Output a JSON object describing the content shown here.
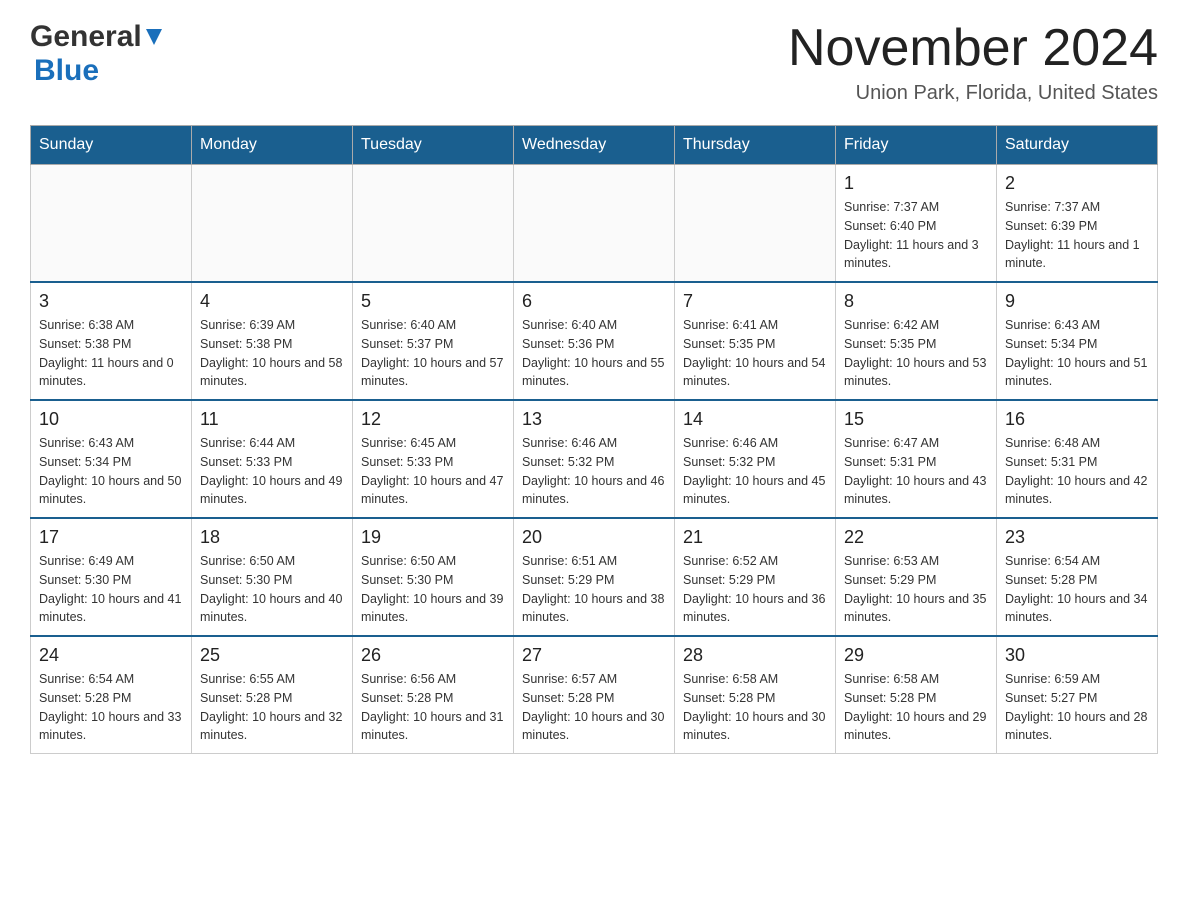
{
  "logo": {
    "general": "General",
    "triangle": "▶",
    "blue": "Blue"
  },
  "title": "November 2024",
  "subtitle": "Union Park, Florida, United States",
  "days_of_week": [
    "Sunday",
    "Monday",
    "Tuesday",
    "Wednesday",
    "Thursday",
    "Friday",
    "Saturday"
  ],
  "weeks": [
    [
      {
        "day": "",
        "info": ""
      },
      {
        "day": "",
        "info": ""
      },
      {
        "day": "",
        "info": ""
      },
      {
        "day": "",
        "info": ""
      },
      {
        "day": "",
        "info": ""
      },
      {
        "day": "1",
        "info": "Sunrise: 7:37 AM\nSunset: 6:40 PM\nDaylight: 11 hours and 3 minutes."
      },
      {
        "day": "2",
        "info": "Sunrise: 7:37 AM\nSunset: 6:39 PM\nDaylight: 11 hours and 1 minute."
      }
    ],
    [
      {
        "day": "3",
        "info": "Sunrise: 6:38 AM\nSunset: 5:38 PM\nDaylight: 11 hours and 0 minutes."
      },
      {
        "day": "4",
        "info": "Sunrise: 6:39 AM\nSunset: 5:38 PM\nDaylight: 10 hours and 58 minutes."
      },
      {
        "day": "5",
        "info": "Sunrise: 6:40 AM\nSunset: 5:37 PM\nDaylight: 10 hours and 57 minutes."
      },
      {
        "day": "6",
        "info": "Sunrise: 6:40 AM\nSunset: 5:36 PM\nDaylight: 10 hours and 55 minutes."
      },
      {
        "day": "7",
        "info": "Sunrise: 6:41 AM\nSunset: 5:35 PM\nDaylight: 10 hours and 54 minutes."
      },
      {
        "day": "8",
        "info": "Sunrise: 6:42 AM\nSunset: 5:35 PM\nDaylight: 10 hours and 53 minutes."
      },
      {
        "day": "9",
        "info": "Sunrise: 6:43 AM\nSunset: 5:34 PM\nDaylight: 10 hours and 51 minutes."
      }
    ],
    [
      {
        "day": "10",
        "info": "Sunrise: 6:43 AM\nSunset: 5:34 PM\nDaylight: 10 hours and 50 minutes."
      },
      {
        "day": "11",
        "info": "Sunrise: 6:44 AM\nSunset: 5:33 PM\nDaylight: 10 hours and 49 minutes."
      },
      {
        "day": "12",
        "info": "Sunrise: 6:45 AM\nSunset: 5:33 PM\nDaylight: 10 hours and 47 minutes."
      },
      {
        "day": "13",
        "info": "Sunrise: 6:46 AM\nSunset: 5:32 PM\nDaylight: 10 hours and 46 minutes."
      },
      {
        "day": "14",
        "info": "Sunrise: 6:46 AM\nSunset: 5:32 PM\nDaylight: 10 hours and 45 minutes."
      },
      {
        "day": "15",
        "info": "Sunrise: 6:47 AM\nSunset: 5:31 PM\nDaylight: 10 hours and 43 minutes."
      },
      {
        "day": "16",
        "info": "Sunrise: 6:48 AM\nSunset: 5:31 PM\nDaylight: 10 hours and 42 minutes."
      }
    ],
    [
      {
        "day": "17",
        "info": "Sunrise: 6:49 AM\nSunset: 5:30 PM\nDaylight: 10 hours and 41 minutes."
      },
      {
        "day": "18",
        "info": "Sunrise: 6:50 AM\nSunset: 5:30 PM\nDaylight: 10 hours and 40 minutes."
      },
      {
        "day": "19",
        "info": "Sunrise: 6:50 AM\nSunset: 5:30 PM\nDaylight: 10 hours and 39 minutes."
      },
      {
        "day": "20",
        "info": "Sunrise: 6:51 AM\nSunset: 5:29 PM\nDaylight: 10 hours and 38 minutes."
      },
      {
        "day": "21",
        "info": "Sunrise: 6:52 AM\nSunset: 5:29 PM\nDaylight: 10 hours and 36 minutes."
      },
      {
        "day": "22",
        "info": "Sunrise: 6:53 AM\nSunset: 5:29 PM\nDaylight: 10 hours and 35 minutes."
      },
      {
        "day": "23",
        "info": "Sunrise: 6:54 AM\nSunset: 5:28 PM\nDaylight: 10 hours and 34 minutes."
      }
    ],
    [
      {
        "day": "24",
        "info": "Sunrise: 6:54 AM\nSunset: 5:28 PM\nDaylight: 10 hours and 33 minutes."
      },
      {
        "day": "25",
        "info": "Sunrise: 6:55 AM\nSunset: 5:28 PM\nDaylight: 10 hours and 32 minutes."
      },
      {
        "day": "26",
        "info": "Sunrise: 6:56 AM\nSunset: 5:28 PM\nDaylight: 10 hours and 31 minutes."
      },
      {
        "day": "27",
        "info": "Sunrise: 6:57 AM\nSunset: 5:28 PM\nDaylight: 10 hours and 30 minutes."
      },
      {
        "day": "28",
        "info": "Sunrise: 6:58 AM\nSunset: 5:28 PM\nDaylight: 10 hours and 30 minutes."
      },
      {
        "day": "29",
        "info": "Sunrise: 6:58 AM\nSunset: 5:28 PM\nDaylight: 10 hours and 29 minutes."
      },
      {
        "day": "30",
        "info": "Sunrise: 6:59 AM\nSunset: 5:27 PM\nDaylight: 10 hours and 28 minutes."
      }
    ]
  ]
}
